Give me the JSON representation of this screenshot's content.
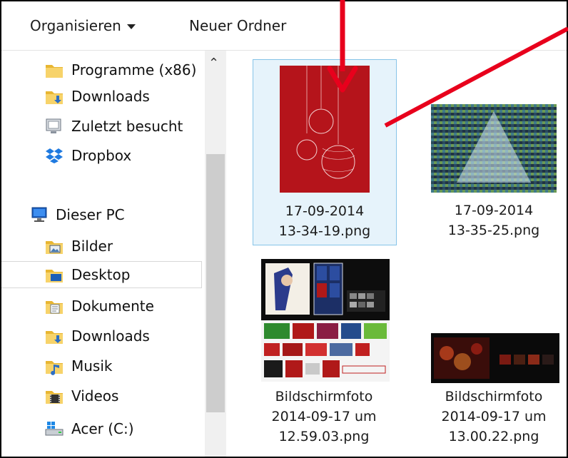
{
  "toolbar": {
    "organize_label": "Organisieren",
    "new_folder_label": "Neuer Ordner"
  },
  "nav": {
    "items": [
      {
        "label": "Programme (x86)",
        "icon": "folder-icon"
      },
      {
        "label": "Downloads",
        "icon": "downloads-folder-icon"
      },
      {
        "label": "Zuletzt besucht",
        "icon": "recent-places-icon"
      },
      {
        "label": "Dropbox",
        "icon": "dropbox-icon"
      },
      {
        "label": "Dieser PC",
        "icon": "computer-icon"
      },
      {
        "label": "Bilder",
        "icon": "pictures-folder-icon"
      },
      {
        "label": "Desktop",
        "icon": "desktop-folder-icon"
      },
      {
        "label": "Dokumente",
        "icon": "documents-folder-icon"
      },
      {
        "label": "Downloads",
        "icon": "downloads-folder-icon"
      },
      {
        "label": "Musik",
        "icon": "music-folder-icon"
      },
      {
        "label": "Videos",
        "icon": "videos-folder-icon"
      },
      {
        "label": "Acer (C:)",
        "icon": "drive-icon"
      }
    ],
    "selected": "Desktop"
  },
  "files": [
    {
      "line1": "17-09-2014",
      "line2": "13-34-19.png",
      "selected": true
    },
    {
      "line1": "17-09-2014",
      "line2": "13-35-25.png",
      "selected": false
    },
    {
      "line1": "Bildschirmfoto",
      "line2": "2014-09-17 um",
      "line3": "12.59.03.png",
      "selected": false
    },
    {
      "line1": "Bildschirmfoto",
      "line2": "2014-09-17 um",
      "line3": "13.00.22.png",
      "selected": false
    }
  ],
  "colors": {
    "selection_bg": "#e6f3fb",
    "selection_border": "#86c4e8",
    "annotation_arrow": "#e8001c",
    "card_red": "#b5141b"
  }
}
